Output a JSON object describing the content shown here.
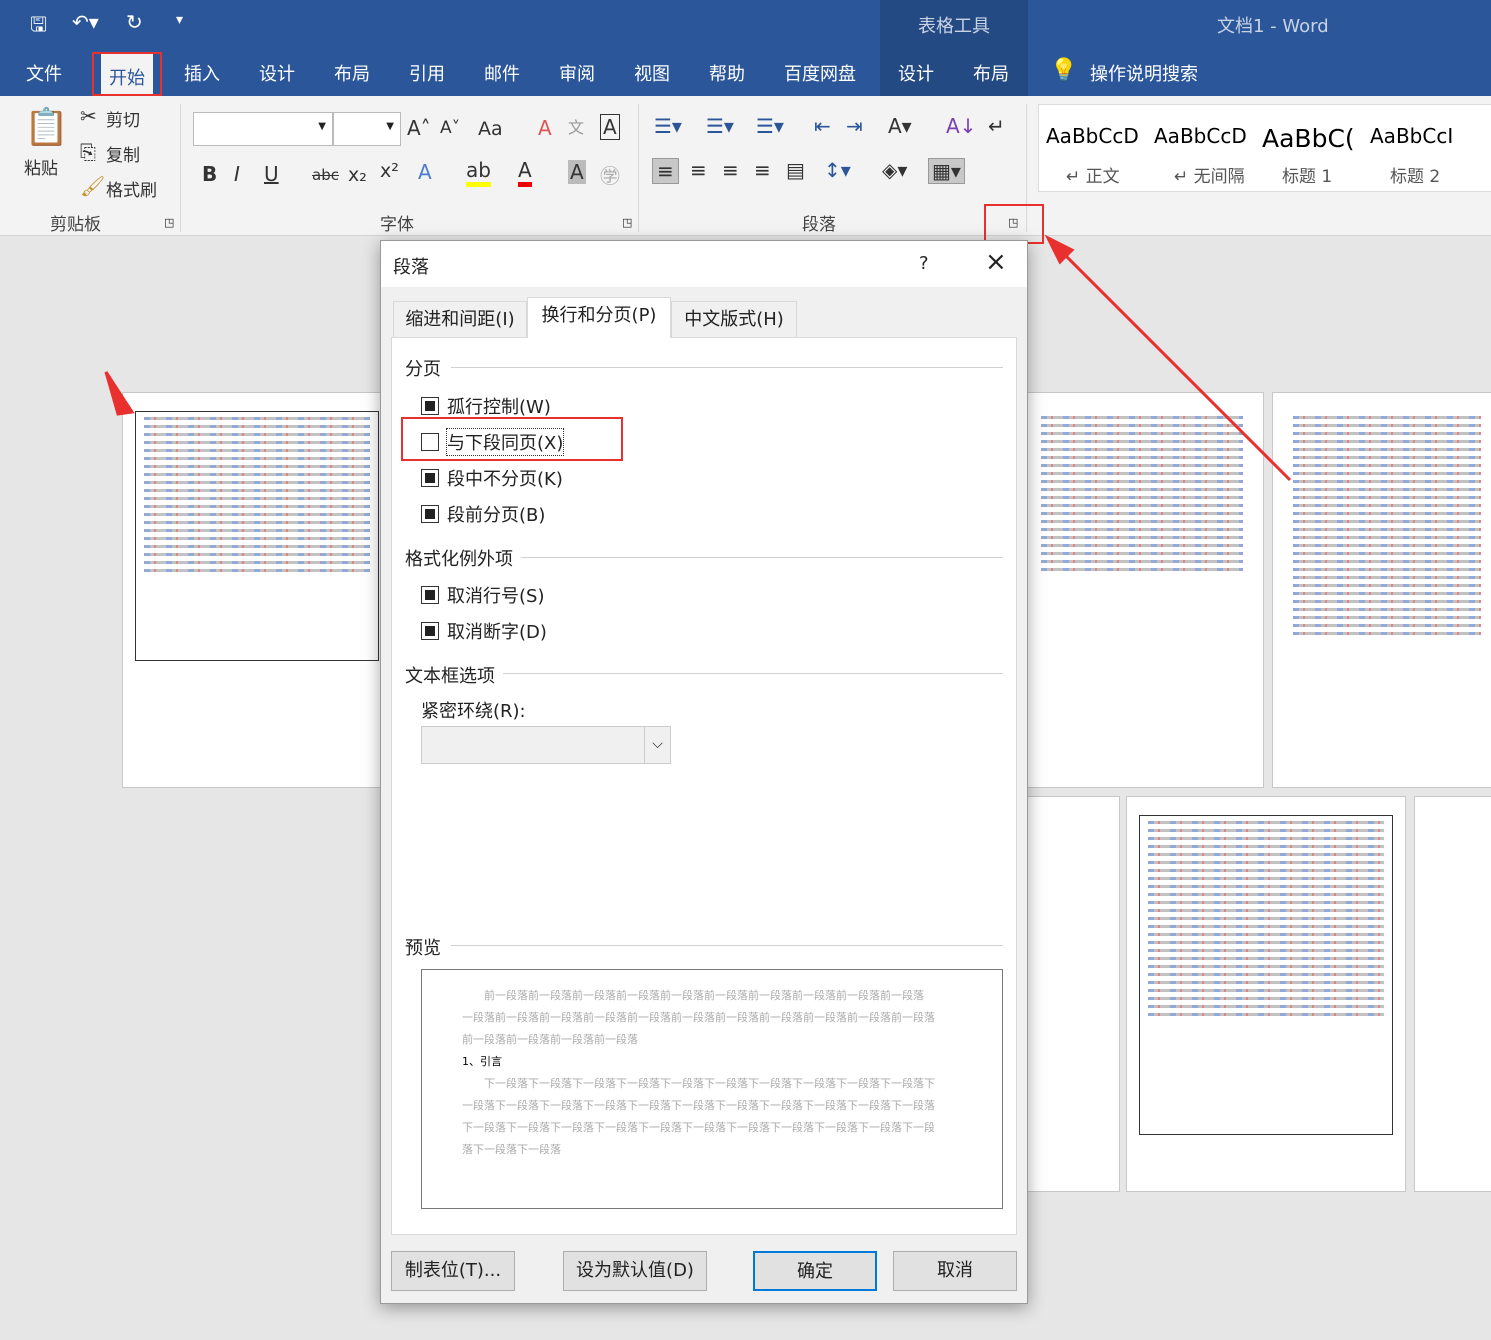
{
  "titlebar": {
    "context_tool": "表格工具",
    "doc_title": "文档1  -  Word"
  },
  "tabs": [
    "文件",
    "开始",
    "插入",
    "设计",
    "布局",
    "引用",
    "邮件",
    "审阅",
    "视图",
    "帮助",
    "百度网盘",
    "设计",
    "布局"
  ],
  "active_tab": "开始",
  "tell_me": "操作说明搜索",
  "ribbon": {
    "clipboard": {
      "paste": "粘贴",
      "cut": "剪切",
      "copy": "复制",
      "format_painter": "格式刷",
      "group": "剪贴板"
    },
    "font": {
      "group": "字体",
      "font_name": "",
      "font_size": "",
      "change_case": "Aa",
      "bold": "B",
      "italic": "I",
      "underline": "U",
      "strike": "abc",
      "sub": "x₂",
      "sup": "x²"
    },
    "paragraph": {
      "group": "段落"
    },
    "styles": [
      {
        "preview": "AaBbCcD",
        "name": "↵ 正文"
      },
      {
        "preview": "AaBbCcD",
        "name": "↵ 无间隔"
      },
      {
        "preview": "AaBbC(",
        "name": "标题 1"
      },
      {
        "preview": "AaBbCcI",
        "name": "标题 2"
      }
    ]
  },
  "dialog": {
    "title": "段落",
    "help": "?",
    "close": "×",
    "tabs": [
      "缩进和间距(I)",
      "换行和分页(P)",
      "中文版式(H)"
    ],
    "active_tab": 1,
    "pagination": {
      "label": "分页",
      "items": [
        {
          "label": "孤行控制(W)",
          "checked": true
        },
        {
          "label": "与下段同页(X)",
          "checked": false
        },
        {
          "label": "段中不分页(K)",
          "checked": true
        },
        {
          "label": "段前分页(B)",
          "checked": true
        }
      ]
    },
    "exceptions": {
      "label": "格式化例外项",
      "items": [
        {
          "label": "取消行号(S)",
          "checked": true
        },
        {
          "label": "取消断字(D)",
          "checked": true
        }
      ]
    },
    "textbox": {
      "label": "文本框选项",
      "wrap_label": "紧密环绕(R):",
      "wrap_value": ""
    },
    "preview": {
      "label": "预览",
      "before": [
        "前一段落前一段落前一段落前一段落前一段落前一段落前一段落前一段落前一段落前一段落",
        "一段落前一段落前一段落前一段落前一段落前一段落前一段落前一段落前一段落前一段落前一段落",
        "前一段落前一段落前一段落前一段落"
      ],
      "current": "1、引言",
      "after": [
        "下一段落下一段落下一段落下一段落下一段落下一段落下一段落下一段落下一段落下一段落下",
        "一段落下一段落下一段落下一段落下一段落下一段落下一段落下一段落下一段落下一段落下一段落",
        "下一段落下一段落下一段落下一段落下一段落下一段落下一段落下一段落下一段落下一段落下一段",
        "落下一段落下一段落"
      ]
    },
    "buttons": {
      "tabs": "制表位(T)...",
      "default": "设为默认值(D)",
      "ok": "确定",
      "cancel": "取消"
    }
  },
  "colors": {
    "brand": "#2b579a",
    "highlight_box": "#e8302f"
  }
}
